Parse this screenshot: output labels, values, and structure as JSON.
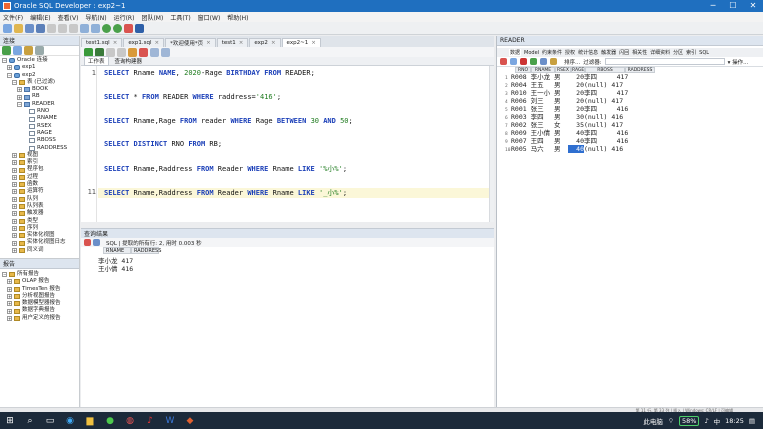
{
  "window": {
    "title": "Oracle SQL Developer : exp2~1",
    "controls": [
      "─",
      "☐",
      "✕"
    ]
  },
  "menu": [
    "文件(F)",
    "编辑(E)",
    "查看(V)",
    "导航(N)",
    "运行(R)",
    "团队(M)",
    "工具(T)",
    "窗口(W)",
    "帮助(H)"
  ],
  "connections": {
    "header": "连接",
    "tree": [
      {
        "level": 0,
        "exp": "−",
        "icon": "db",
        "label": "Oracle 连接"
      },
      {
        "level": 1,
        "exp": "+",
        "icon": "db",
        "label": "exp1"
      },
      {
        "level": 1,
        "exp": "−",
        "icon": "db",
        "label": "exp2"
      },
      {
        "level": 2,
        "exp": "−",
        "icon": "fld",
        "label": "表 (已过滤)"
      },
      {
        "level": 3,
        "exp": "+",
        "icon": "tbl",
        "label": "BOOK"
      },
      {
        "level": 3,
        "exp": "+",
        "icon": "tbl",
        "label": "RB"
      },
      {
        "level": 3,
        "exp": "−",
        "icon": "tbl",
        "label": "READER"
      },
      {
        "level": 4,
        "exp": "",
        "icon": "col",
        "label": "RNO"
      },
      {
        "level": 4,
        "exp": "",
        "icon": "col",
        "label": "RNAME"
      },
      {
        "level": 4,
        "exp": "",
        "icon": "col",
        "label": "RSEX"
      },
      {
        "level": 4,
        "exp": "",
        "icon": "col",
        "label": "RAGE"
      },
      {
        "level": 4,
        "exp": "",
        "icon": "col",
        "label": "RBOSS"
      },
      {
        "level": 4,
        "exp": "",
        "icon": "col",
        "label": "RADDRESS"
      },
      {
        "level": 2,
        "exp": "+",
        "icon": "fld",
        "label": "视图"
      },
      {
        "level": 2,
        "exp": "+",
        "icon": "fld",
        "label": "索引"
      },
      {
        "level": 2,
        "exp": "+",
        "icon": "fld",
        "label": "程序包"
      },
      {
        "level": 2,
        "exp": "+",
        "icon": "fld",
        "label": "过程"
      },
      {
        "level": 2,
        "exp": "+",
        "icon": "fld",
        "label": "函数"
      },
      {
        "level": 2,
        "exp": "+",
        "icon": "fld",
        "label": "运算符"
      },
      {
        "level": 2,
        "exp": "+",
        "icon": "fld",
        "label": "队列"
      },
      {
        "level": 2,
        "exp": "+",
        "icon": "fld",
        "label": "队列表"
      },
      {
        "level": 2,
        "exp": "+",
        "icon": "fld",
        "label": "触发器"
      },
      {
        "level": 2,
        "exp": "+",
        "icon": "fld",
        "label": "类型"
      },
      {
        "level": 2,
        "exp": "+",
        "icon": "fld",
        "label": "序列"
      },
      {
        "level": 2,
        "exp": "+",
        "icon": "fld",
        "label": "实体化视图"
      },
      {
        "level": 2,
        "exp": "+",
        "icon": "fld",
        "label": "实体化视图日志"
      },
      {
        "level": 2,
        "exp": "+",
        "icon": "fld",
        "label": "同义词"
      }
    ]
  },
  "reports": {
    "header": "报告",
    "items": [
      "所有报告",
      "OLAP 报告",
      "TimesTen 报告",
      "分析视图报告",
      "数据模型器报告",
      "数据字典报告",
      "用户定义的报告"
    ]
  },
  "doc_tabs": [
    {
      "label": "test1.sql",
      "active": false
    },
    {
      "label": "exp1.sql",
      "active": false
    },
    {
      "label": "*欢迎使用*页",
      "active": false
    },
    {
      "label": "test1",
      "active": false
    },
    {
      "label": "exp2",
      "active": false
    },
    {
      "label": "exp2~1",
      "active": true
    }
  ],
  "editor": {
    "subtabs": [
      "工作表",
      "查询构建器"
    ],
    "lines": [
      {
        "n": "1",
        "code": [
          [
            "kw",
            "SELECT"
          ],
          [
            "t",
            " Rname "
          ],
          [
            "kw",
            "NAME"
          ],
          [
            "t",
            ", "
          ],
          [
            "num",
            "2020"
          ],
          [
            "t",
            "-Rage "
          ],
          [
            "kw",
            "BIRTHDAY"
          ],
          [
            "t",
            " "
          ],
          [
            "kw",
            "FROM"
          ],
          [
            "t",
            " READER;"
          ]
        ]
      },
      {
        "n": "",
        "code": []
      },
      {
        "n": "",
        "code": [
          [
            "kw",
            "SELECT"
          ],
          [
            "t",
            " * "
          ],
          [
            "kw",
            "FROM"
          ],
          [
            "t",
            " READER "
          ],
          [
            "kw",
            "WHERE"
          ],
          [
            "t",
            " raddress="
          ],
          [
            "str",
            "'416'"
          ],
          [
            "t",
            ";"
          ]
        ]
      },
      {
        "n": "",
        "code": []
      },
      {
        "n": "",
        "code": [
          [
            "kw",
            "SELECT"
          ],
          [
            "t",
            " Rname,Rage "
          ],
          [
            "kw",
            "FROM"
          ],
          [
            "t",
            " reader "
          ],
          [
            "kw",
            "WHERE"
          ],
          [
            "t",
            " Rage "
          ],
          [
            "kw",
            "BETWEEN"
          ],
          [
            "t",
            " "
          ],
          [
            "num",
            "30"
          ],
          [
            "t",
            " "
          ],
          [
            "kw",
            "AND"
          ],
          [
            "t",
            " "
          ],
          [
            "num",
            "50"
          ],
          [
            "t",
            ";"
          ]
        ]
      },
      {
        "n": "",
        "code": []
      },
      {
        "n": "",
        "code": [
          [
            "kw",
            "SELECT"
          ],
          [
            "t",
            " "
          ],
          [
            "kw",
            "DISTINCT"
          ],
          [
            "t",
            " RNO "
          ],
          [
            "kw",
            "FROM"
          ],
          [
            "t",
            " RB;"
          ]
        ]
      },
      {
        "n": "",
        "code": []
      },
      {
        "n": "",
        "code": [
          [
            "kw",
            "SELECT"
          ],
          [
            "t",
            " Rname,Raddress "
          ],
          [
            "kw",
            "FROM"
          ],
          [
            "t",
            " Reader "
          ],
          [
            "kw",
            "WHERE"
          ],
          [
            "t",
            " Rname "
          ],
          [
            "kw",
            "LIKE"
          ],
          [
            "t",
            " "
          ],
          [
            "str",
            "'%小%'"
          ],
          [
            "t",
            ";"
          ]
        ]
      },
      {
        "n": "",
        "code": []
      },
      {
        "n": "11",
        "code": [
          [
            "kw",
            "SELECT"
          ],
          [
            "t",
            " Rname,Raddress "
          ],
          [
            "kw",
            "FROM"
          ],
          [
            "t",
            " Reader "
          ],
          [
            "kw",
            "WHERE"
          ],
          [
            "t",
            " Rname "
          ],
          [
            "kw",
            "LIKE"
          ],
          [
            "t",
            " "
          ],
          [
            "str",
            "'_小%'"
          ],
          [
            "t",
            ";"
          ]
        ],
        "highlight": true
      }
    ]
  },
  "result": {
    "header": "查询结果",
    "status": "SQL | 提取的所有行: 2, 用时 0.003 秒",
    "columns": [
      "RNAME",
      "RADDRESS"
    ],
    "rows": [
      [
        "李小龙",
        "417"
      ],
      [
        "王小倩",
        "416"
      ]
    ]
  },
  "reader_panel": {
    "title": "READER",
    "tabs": [
      "数据",
      "Model",
      "约束条件",
      "授权",
      "统计信息",
      "触发器",
      "闪回",
      "相关性",
      "详细资料",
      "分区",
      "索引",
      "SQL"
    ],
    "sort_label": "排序...",
    "filter_label": "过滤器:",
    "actions_label": "▾ 操作...",
    "columns": [
      "RNO",
      "RNAME",
      "RSEX",
      "RAGE",
      "RBOSS",
      "RADDRESS"
    ],
    "rows": [
      {
        "n": "1",
        "rno": "R008",
        "rname": "李小龙",
        "rsex": "男",
        "rage": "20",
        "rboss": "李四",
        "raddr": "417"
      },
      {
        "n": "2",
        "rno": "R004",
        "rname": "王五",
        "rsex": "男",
        "rage": "20",
        "rboss": "(null)",
        "raddr": "417"
      },
      {
        "n": "3",
        "rno": "R010",
        "rname": "王一小",
        "rsex": "男",
        "rage": "20",
        "rboss": "李四",
        "raddr": "417"
      },
      {
        "n": "4",
        "rno": "R006",
        "rname": "刘三",
        "rsex": "男",
        "rage": "20",
        "rboss": "(null)",
        "raddr": "417"
      },
      {
        "n": "5",
        "rno": "R001",
        "rname": "张三",
        "rsex": "男",
        "rage": "20",
        "rboss": "李四",
        "raddr": "416"
      },
      {
        "n": "6",
        "rno": "R003",
        "rname": "李四",
        "rsex": "男",
        "rage": "30",
        "rboss": "(null)",
        "raddr": "416"
      },
      {
        "n": "7",
        "rno": "R002",
        "rname": "张三",
        "rsex": "女",
        "rage": "35",
        "rboss": "(null)",
        "raddr": "417"
      },
      {
        "n": "8",
        "rno": "R009",
        "rname": "王小倩",
        "rsex": "男",
        "rage": "40",
        "rboss": "李四",
        "raddr": "416"
      },
      {
        "n": "9",
        "rno": "R007",
        "rname": "王四",
        "rsex": "男",
        "rage": "40",
        "rboss": "李四",
        "raddr": "416"
      },
      {
        "n": "10",
        "rno": "R005",
        "rname": "马六",
        "rsex": "男",
        "rage": "40",
        "rboss": "(null)",
        "raddr": "416",
        "selected": "rage"
      }
    ]
  },
  "statusbar": "第 11 行, 第 33 列 | 插入 | Windows: CR/LF | 可编辑",
  "taskbar": {
    "tray_text": "此电脑",
    "battery": "58%",
    "ime": "中",
    "time": "18:25"
  }
}
